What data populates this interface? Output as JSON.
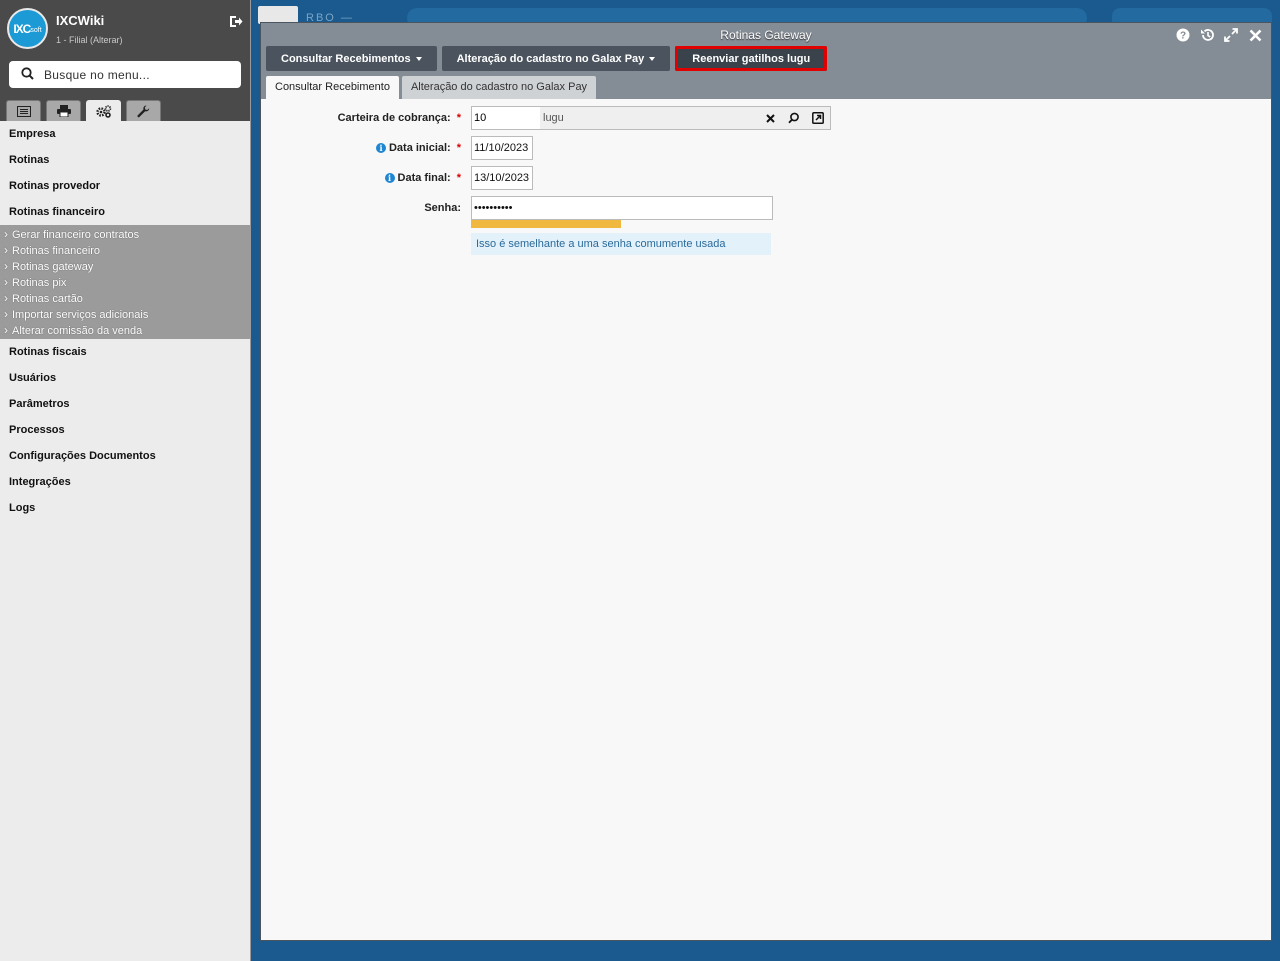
{
  "sidebar": {
    "logo_text": "IXC",
    "logo_small": "soft",
    "app_title": "IXCWiki",
    "branch": "1 - Filial (Alterar)",
    "search_placeholder": "Busque no menu...",
    "tabs": [
      "list-icon",
      "printer-icon",
      "gears-icon",
      "wrench-icon"
    ],
    "menu_top": [
      "Empresa",
      "Rotinas",
      "Rotinas provedor",
      "Rotinas financeiro"
    ],
    "submenu": [
      "Gerar financeiro contratos",
      "Rotinas financeiro",
      "Rotinas gateway",
      "Rotinas pix",
      "Rotinas cartão",
      "Importar serviços adicionais",
      "Alterar comissão da venda"
    ],
    "menu_bottom": [
      "Rotinas fiscais",
      "Usuários",
      "Parâmetros",
      "Processos",
      "Configurações Documentos",
      "Integrações",
      "Logs"
    ]
  },
  "background": {
    "text": "RBO —"
  },
  "window": {
    "title": "Rotinas Gateway",
    "toolbar": {
      "btn1": "Consultar Recebimentos",
      "btn2": "Alteração do cadastro no Galax Pay",
      "btn3": "Reenviar gatilhos lugu"
    },
    "tabs": {
      "tab1": "Consultar Recebimento",
      "tab2": "Alteração do cadastro no Galax Pay"
    },
    "form": {
      "carteira_label": "Carteira de cobrança:",
      "carteira_value": "10",
      "carteira_desc": "lugu",
      "data_inicial_label": "Data inicial:",
      "data_inicial_value": "11/10/2023",
      "data_final_label": "Data final:",
      "data_final_value": "13/10/2023",
      "senha_label": "Senha:",
      "senha_value": "••••••••••",
      "senha_hint": "Isso é semelhante a uma senha comumente usada",
      "required_mark": "*",
      "info_mark": "i"
    }
  },
  "colors": {
    "accent": "#1b9ad6",
    "highlight": "#e00000",
    "strength": "#f0b83e"
  }
}
